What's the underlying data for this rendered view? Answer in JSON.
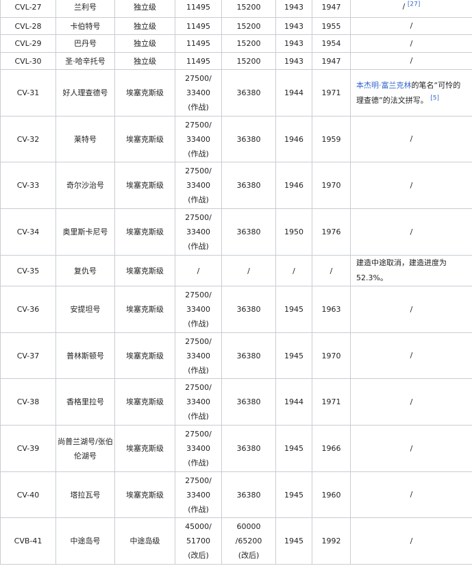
{
  "rows": [
    {
      "hull": "CVL-27",
      "name": "兰利号",
      "cls": "独立级",
      "std": "11495",
      "full": "15200",
      "laid": "1943",
      "end": "1947",
      "note_text": "/",
      "note_ref": "[27]"
    },
    {
      "hull": "CVL-28",
      "name": "卡伯特号",
      "cls": "独立级",
      "std": "11495",
      "full": "15200",
      "laid": "1943",
      "end": "1955",
      "note_text": "/"
    },
    {
      "hull": "CVL-29",
      "name": "巴丹号",
      "cls": "独立级",
      "std": "11495",
      "full": "15200",
      "laid": "1943",
      "end": "1954",
      "note_text": "/"
    },
    {
      "hull": "CVL-30",
      "name": "圣·哈辛托号",
      "cls": "独立级",
      "std": "11495",
      "full": "15200",
      "laid": "1943",
      "end": "1947",
      "note_text": "/"
    },
    {
      "hull": "CV-31",
      "name": "好人理查德号",
      "cls": "埃塞克斯级",
      "std": [
        "27500/",
        "33400",
        "(作战)"
      ],
      "full": "36380",
      "laid": "1944",
      "end": "1971",
      "note_link": "本杰明·富兰克林",
      "note_text": "的笔名“可怜的理查德”的法文拼写。",
      "note_ref": "[5]"
    },
    {
      "hull": "CV-32",
      "name": "莱特号",
      "cls": "埃塞克斯级",
      "std": [
        "27500/",
        "33400",
        "(作战)"
      ],
      "full": "36380",
      "laid": "1946",
      "end": "1959",
      "note_text": "/"
    },
    {
      "hull": "CV-33",
      "name": "奇尔沙治号",
      "cls": "埃塞克斯级",
      "std": [
        "27500/",
        "33400",
        "(作战)"
      ],
      "full": "36380",
      "laid": "1946",
      "end": "1970",
      "note_text": "/"
    },
    {
      "hull": "CV-34",
      "name": "奥里斯卡尼号",
      "cls": "埃塞克斯级",
      "std": [
        "27500/",
        "33400",
        "(作战)"
      ],
      "full": "36380",
      "laid": "1950",
      "end": "1976",
      "note_text": "/"
    },
    {
      "hull": "CV-35",
      "name": "复仇号",
      "cls": "埃塞克斯级",
      "std": "/",
      "full": "/",
      "laid": "/",
      "end": "/",
      "note_text": "建造中途取消，建造进度为52.3%。"
    },
    {
      "hull": "CV-36",
      "name": "安提坦号",
      "cls": "埃塞克斯级",
      "std": [
        "27500/",
        "33400",
        "(作战)"
      ],
      "full": "36380",
      "laid": "1945",
      "end": "1963",
      "note_text": "/"
    },
    {
      "hull": "CV-37",
      "name": "普林斯顿号",
      "cls": "埃塞克斯级",
      "std": [
        "27500/",
        "33400",
        "(作战)"
      ],
      "full": "36380",
      "laid": "1945",
      "end": "1970",
      "note_text": "/"
    },
    {
      "hull": "CV-38",
      "name": "香格里拉号",
      "cls": "埃塞克斯级",
      "std": [
        "27500/",
        "33400",
        "(作战)"
      ],
      "full": "36380",
      "laid": "1944",
      "end": "1971",
      "note_text": "/"
    },
    {
      "hull": "CV-39",
      "name": "尚普兰湖号/张伯伦湖号",
      "cls": "埃塞克斯级",
      "std": [
        "27500/",
        "33400",
        "(作战)"
      ],
      "full": "36380",
      "laid": "1945",
      "end": "1966",
      "note_text": "/"
    },
    {
      "hull": "CV-40",
      "name": "塔拉瓦号",
      "cls": "埃塞克斯级",
      "std": [
        "27500/",
        "33400",
        "(作战)"
      ],
      "full": "36380",
      "laid": "1945",
      "end": "1960",
      "note_text": "/"
    },
    {
      "hull": "CVB-41",
      "name": "中途岛号",
      "cls": "中途岛级",
      "std": [
        "45000/",
        "51700",
        "(改后)"
      ],
      "full": [
        "60000",
        "/65200",
        "(改后)"
      ],
      "laid": "1945",
      "end": "1992",
      "note_text": "/"
    }
  ]
}
